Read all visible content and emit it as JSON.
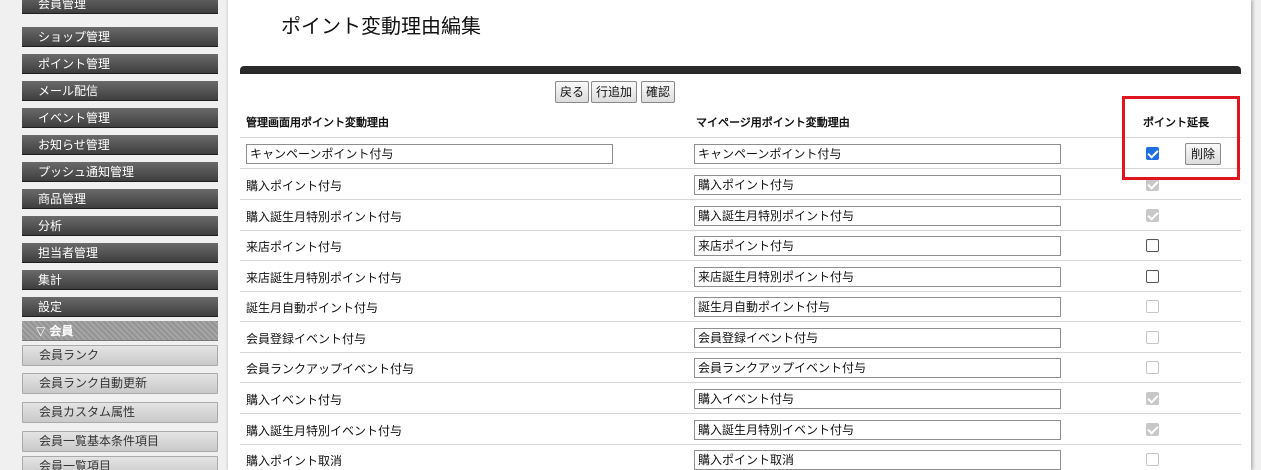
{
  "sidebar": {
    "nav": [
      "会員管理",
      "ショップ管理",
      "ポイント管理",
      "メール配信",
      "イベント管理",
      "お知らせ管理",
      "プッシュ通知管理",
      "商品管理",
      "分析",
      "担当者管理",
      "集計",
      "設定"
    ],
    "section_header": "▽ 会員",
    "sub_items": [
      "会員ランク",
      "会員ランク自動更新",
      "会員カスタム属性",
      "会員一覧基本条件項目",
      "会員一覧項目"
    ]
  },
  "page": {
    "title": "ポイント変動理由編集"
  },
  "toolbar": {
    "back_label": "戻る",
    "add_row_label": "行追加",
    "confirm_label": "確認"
  },
  "table": {
    "headers": {
      "admin_reason": "管理画面用ポイント変動理由",
      "mypage_reason": "マイページ用ポイント変動理由",
      "point_extension": "ポイント延長"
    },
    "delete_label": "削除",
    "rows": [
      {
        "admin": "キャンペーンポイント付与",
        "mypage": "キャンペーンポイント付与",
        "extension": "checked",
        "admin_editable": true,
        "deletable": true
      },
      {
        "admin": "購入ポイント付与",
        "mypage": "購入ポイント付与",
        "extension": "disabled-checked"
      },
      {
        "admin": "購入誕生月特別ポイント付与",
        "mypage": "購入誕生月特別ポイント付与",
        "extension": "disabled-checked"
      },
      {
        "admin": "来店ポイント付与",
        "mypage": "来店ポイント付与",
        "extension": "unchecked"
      },
      {
        "admin": "来店誕生月特別ポイント付与",
        "mypage": "来店誕生月特別ポイント付与",
        "extension": "unchecked"
      },
      {
        "admin": "誕生月自動ポイント付与",
        "mypage": "誕生月自動ポイント付与",
        "extension": "disabled-unchecked"
      },
      {
        "admin": "会員登録イベント付与",
        "mypage": "会員登録イベント付与",
        "extension": "disabled-unchecked"
      },
      {
        "admin": "会員ランクアップイベント付与",
        "mypage": "会員ランクアップイベント付与",
        "extension": "disabled-unchecked"
      },
      {
        "admin": "購入イベント付与",
        "mypage": "購入イベント付与",
        "extension": "disabled-checked"
      },
      {
        "admin": "購入誕生月特別イベント付与",
        "mypage": "購入誕生月特別イベント付与",
        "extension": "disabled-checked"
      },
      {
        "admin": "購入ポイント取消",
        "mypage": "購入ポイント取消",
        "extension": "disabled-unchecked"
      }
    ]
  },
  "colors": {
    "highlight": "#e0141e",
    "checkbox_checked": "#1f6fe0",
    "nav_bg": "#3e3e3e"
  }
}
